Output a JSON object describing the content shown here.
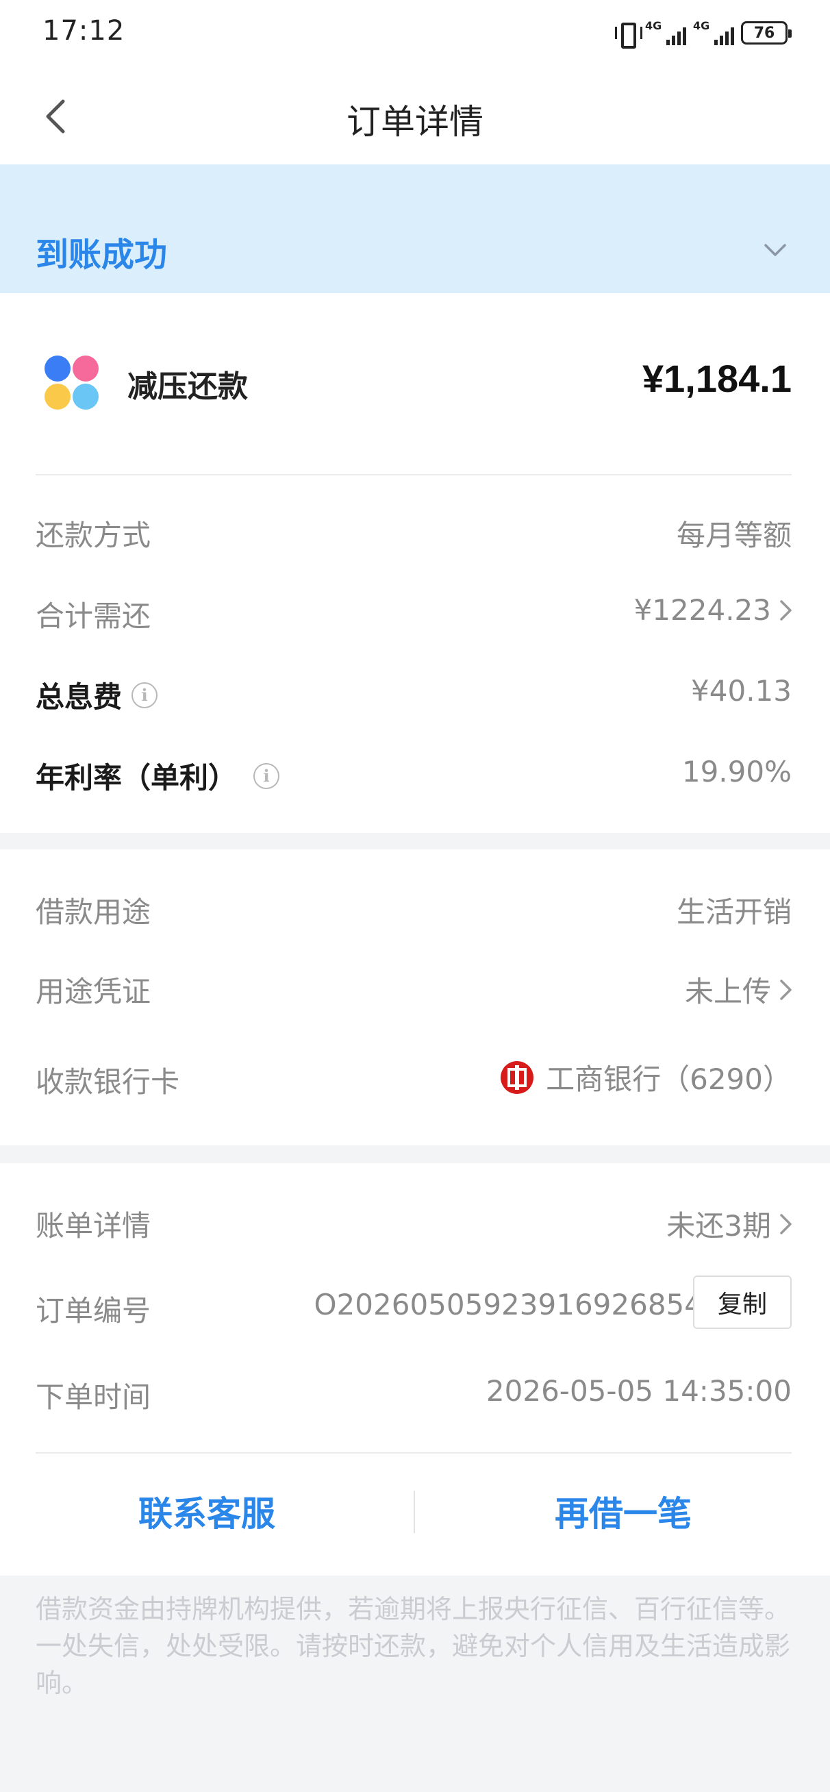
{
  "status_bar": {
    "time": "17:12",
    "network_1": "4G",
    "network_2": "4G",
    "battery": "76"
  },
  "header": {
    "title": "订单详情"
  },
  "banner": {
    "status": "到账成功"
  },
  "product": {
    "name": "减压还款",
    "amount": "¥1,184.1"
  },
  "repayment": [
    {
      "label": "还款方式",
      "value": "每月等额"
    },
    {
      "label": "合计需还",
      "value": "¥1224.23"
    },
    {
      "label": "总息费",
      "value": "¥40.13"
    },
    {
      "label": "年利率（单利）",
      "value": "19.90%"
    }
  ],
  "loan": [
    {
      "label": "借款用途",
      "value": "生活开销"
    },
    {
      "label": "用途凭证",
      "value": "未上传"
    },
    {
      "label": "收款银行卡",
      "value": "工商银行（6290）"
    }
  ],
  "order": [
    {
      "label": "账单详情",
      "value": "未还3期"
    },
    {
      "label": "订单编号",
      "value": "O20260505923916926854"
    },
    {
      "label": "下单时间",
      "value": "2026-05-05 14:35:00"
    }
  ],
  "copy_label": "复制",
  "actions": {
    "contact": "联系客服",
    "borrow_again": "再借一笔"
  },
  "disclaimer": "借款资金由持牌机构提供，若逾期将上报央行征信、百行征信等。一处失信，处处受限。请按时还款，避免对个人信用及生活造成影响。",
  "colors": {
    "accent": "#2a86e8",
    "banner_bg": "#dbeefc",
    "bank_red": "#d71a1a"
  }
}
